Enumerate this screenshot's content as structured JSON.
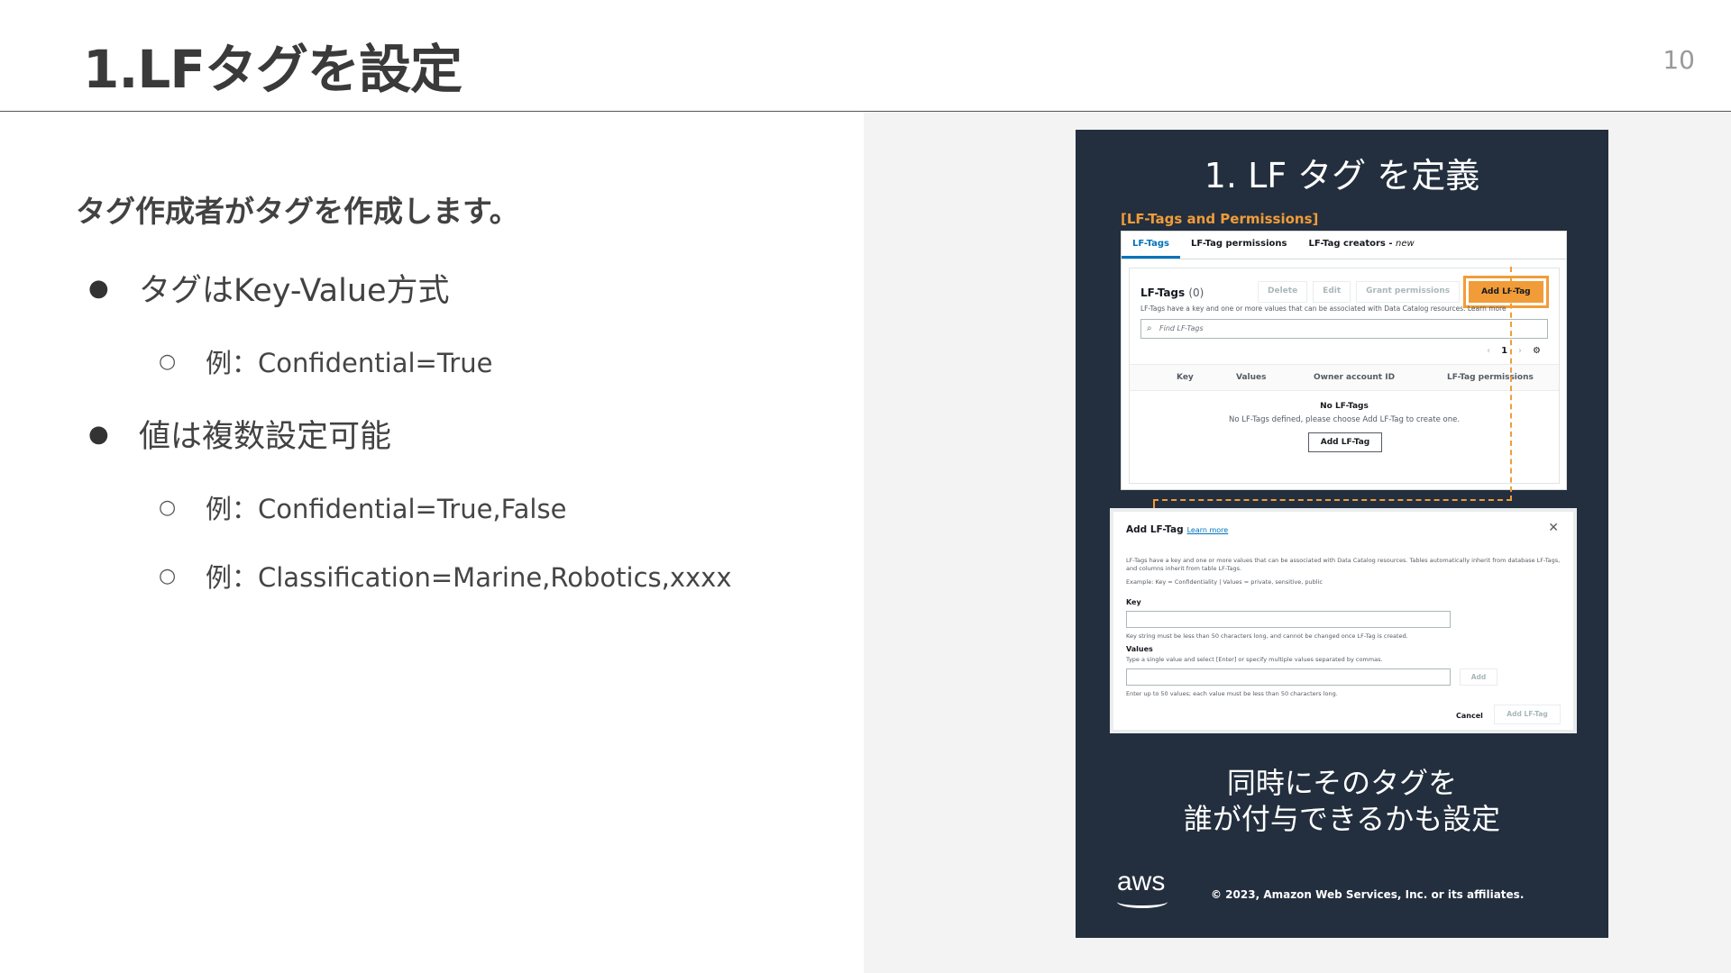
{
  "slide": {
    "title": "1.LFタグを設定",
    "page_number": "10"
  },
  "content": {
    "lead": "タグ作成者がタグを作成します。",
    "bullets": [
      {
        "text": "タグはKey-Value方式",
        "subs": [
          "例：Confidential=True"
        ]
      },
      {
        "text": "値は複数設定可能",
        "subs": [
          "例：Confidential=True,False",
          "例：Classification=Marine,Robotics,xxxx"
        ]
      }
    ],
    "bullet_glyph": "●",
    "sub_glyph": "○"
  },
  "figure": {
    "title": "1. LF タグ を定義",
    "section_label": "[LF-Tags and Permissions]",
    "console": {
      "tabs": [
        "LF-Tags",
        "LF-Tag permissions",
        "LF-Tag creators - ",
        "new"
      ],
      "heading": "LF-Tags",
      "count": "(0)",
      "buttons": [
        "Delete",
        "Edit",
        "Grant permissions"
      ],
      "primary_button": "Add LF-Tag",
      "description": "LF-Tags have a key and one or more values that can be associated with Data Catalog resources. Learn more",
      "search_placeholder": "Find LF-Tags",
      "page": "1",
      "columns": [
        "Key",
        "Values",
        "Owner account ID",
        "LF-Tag permissions"
      ],
      "empty_title": "No LF-Tags",
      "empty_desc": "No LF-Tags defined, please choose Add LF-Tag to create one.",
      "empty_button": "Add LF-Tag"
    },
    "modal": {
      "title": "Add LF-Tag",
      "learn_more": "Learn more",
      "desc1": "LF-Tags have a key and one or more values that can be associated with Data Catalog resources. Tables automatically inherit from database LF-Tags, and columns inherit from table LF-Tags.",
      "desc2": "Example: Key = Confidentiality | Values = private, sensitive, public",
      "key_label": "Key",
      "key_hint": "Key string must be less than 50 characters long, and cannot be changed once LF-Tag is created.",
      "values_label": "Values",
      "values_hint": "Type a single value and select [Enter] or specify multiple values separated by commas.",
      "values_hint2": "Enter up to 50 values; each value must be less than 50 characters long.",
      "add_button": "Add",
      "cancel": "Cancel",
      "submit": "Add LF-Tag"
    },
    "caption_line1": "同時にそのタグを",
    "caption_line2": "誰が付与できるかも設定",
    "logo_text": "aws",
    "copyright": "© 2023, Amazon Web Services, Inc. or its affiliates.",
    "accent": "#f19c38",
    "card_bg": "#232f3e"
  }
}
